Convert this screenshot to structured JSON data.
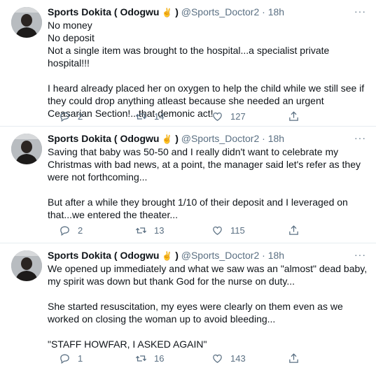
{
  "tweets": [
    {
      "name": "Sports Dokita ( Odogwu",
      "emoji": "✌",
      "name_close": ")",
      "handle": "@Sports_Doctor2",
      "dot": "·",
      "time": "18h",
      "more": "···",
      "text": "No money\nNo deposit\nNot a single item was brought to the hospital...a specialist private hospital!!!\n\nI heard already placed her on oxygen to help the child while we still see if they could drop anything atleast because she needed an urgent Ceasarian Section!...that demonic act!",
      "replies": "2",
      "retweets": "14",
      "likes": "127"
    },
    {
      "name": "Sports Dokita ( Odogwu",
      "emoji": "✌",
      "name_close": ")",
      "handle": "@Sports_Doctor2",
      "dot": "·",
      "time": "18h",
      "more": "···",
      "text": "Saving that baby was 50-50 and I really didn't want to celebrate my Christmas with bad news, at a point, the manager said let's refer as they were not forthcoming...\n\nBut after a while they brought 1/10 of their deposit and I leveraged on that...we entered the theater...",
      "replies": "2",
      "retweets": "13",
      "likes": "115"
    },
    {
      "name": "Sports Dokita ( Odogwu",
      "emoji": "✌",
      "name_close": ")",
      "handle": "@Sports_Doctor2",
      "dot": "·",
      "time": "18h",
      "more": "···",
      "text": "We opened up immediately and what we saw was an \"almost\" dead baby, my spirit was down but thank God for the nurse on duty...\n\nShe started resuscitation, my eyes were clearly on them even as we worked on closing the woman up to avoid bleeding...\n\n\"STAFF HOWFAR, I ASKED AGAIN\"",
      "replies": "1",
      "retweets": "16",
      "likes": "143"
    }
  ]
}
